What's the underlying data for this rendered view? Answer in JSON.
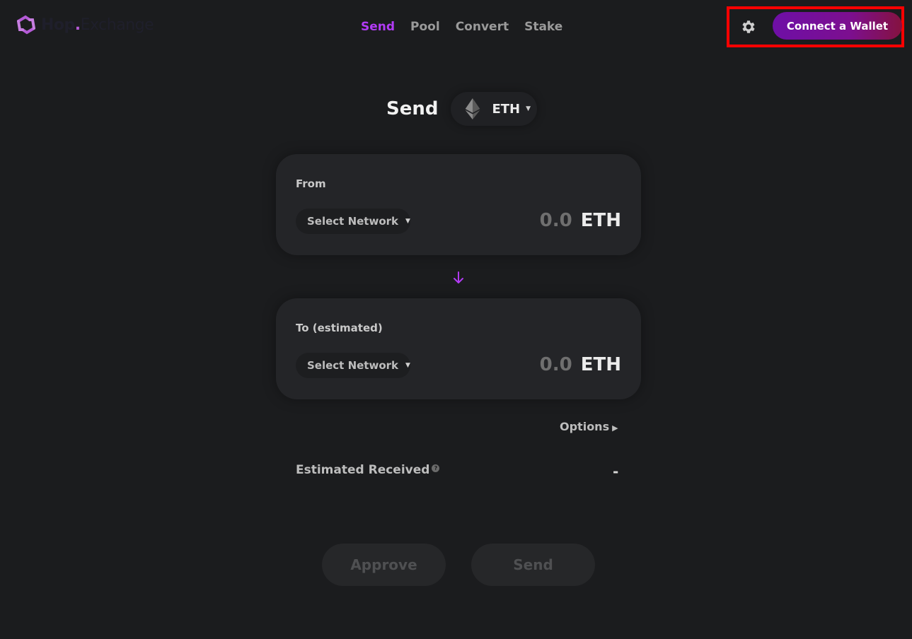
{
  "brand": {
    "name_part1": "Hop",
    "name_dot": ".",
    "name_part2": "Exchange",
    "accent": "#b23bf5"
  },
  "nav": {
    "items": [
      "Send",
      "Pool",
      "Convert",
      "Stake"
    ],
    "active": "Send"
  },
  "header": {
    "settings_icon": "gear-icon",
    "connect_wallet_label": "Connect a Wallet"
  },
  "main": {
    "title": "Send",
    "token": {
      "label": "ETH",
      "icon": "ethereum-icon"
    }
  },
  "from_card": {
    "label": "From",
    "network_label": "Select Network",
    "amount": "0.0",
    "unit": "ETH"
  },
  "to_card": {
    "label": "To (estimated)",
    "network_label": "Select Network",
    "amount": "0.0",
    "unit": "ETH"
  },
  "options": {
    "label": "Options"
  },
  "estimate": {
    "label": "Estimated Received",
    "value": "-",
    "help_icon": "question-icon"
  },
  "actions": {
    "approve_label": "Approve",
    "send_label": "Send"
  }
}
